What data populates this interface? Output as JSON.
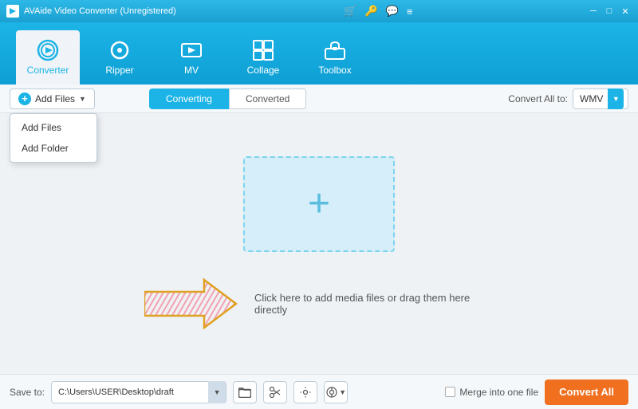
{
  "app": {
    "title": "AVAide Video Converter (Unregistered)"
  },
  "navbar": {
    "items": [
      {
        "id": "converter",
        "label": "Converter",
        "active": true
      },
      {
        "id": "ripper",
        "label": "Ripper",
        "active": false
      },
      {
        "id": "mv",
        "label": "MV",
        "active": false
      },
      {
        "id": "collage",
        "label": "Collage",
        "active": false
      },
      {
        "id": "toolbox",
        "label": "Toolbox",
        "active": false
      }
    ]
  },
  "subtoolbar": {
    "add_files_label": "Add Files",
    "dropdown_items": [
      "Add Files",
      "Add Folder"
    ],
    "tabs": [
      "Converting",
      "Converted"
    ],
    "active_tab": "Converting",
    "convert_all_label": "Convert All to:",
    "format": "WMV"
  },
  "dropzone": {
    "hint": "Click here to add media files or drag them here directly"
  },
  "bottombar": {
    "save_to_label": "Save to:",
    "save_path": "C:\\Users\\USER\\Desktop\\draft",
    "merge_label": "Merge into one file",
    "convert_btn": "Convert All"
  }
}
